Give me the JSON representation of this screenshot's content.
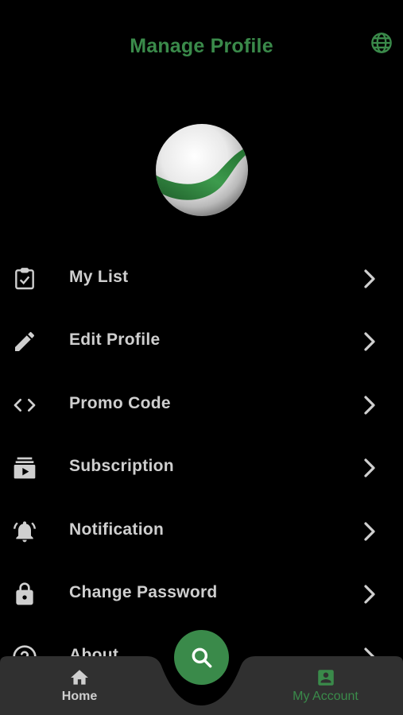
{
  "header": {
    "title": "Manage Profile",
    "language_icon": "globe-icon"
  },
  "menu": [
    {
      "label": "My List",
      "icon": "clipboard-check-icon"
    },
    {
      "label": "Edit Profile",
      "icon": "pencil-icon"
    },
    {
      "label": "Promo Code",
      "icon": "code-icon"
    },
    {
      "label": "Subscription",
      "icon": "subscriptions-icon"
    },
    {
      "label": "Notification",
      "icon": "bell-icon"
    },
    {
      "label": "Change Password",
      "icon": "lock-icon"
    },
    {
      "label": "About",
      "icon": "help-circle-icon"
    }
  ],
  "tabbar": {
    "home_label": "Home",
    "account_label": "My Account",
    "active_tab": "My Account",
    "search_icon": "search-icon"
  },
  "colors": {
    "accent": "#3a8a4a",
    "background": "#000000",
    "tabbar": "#303030",
    "text": "#cfcfcf"
  }
}
